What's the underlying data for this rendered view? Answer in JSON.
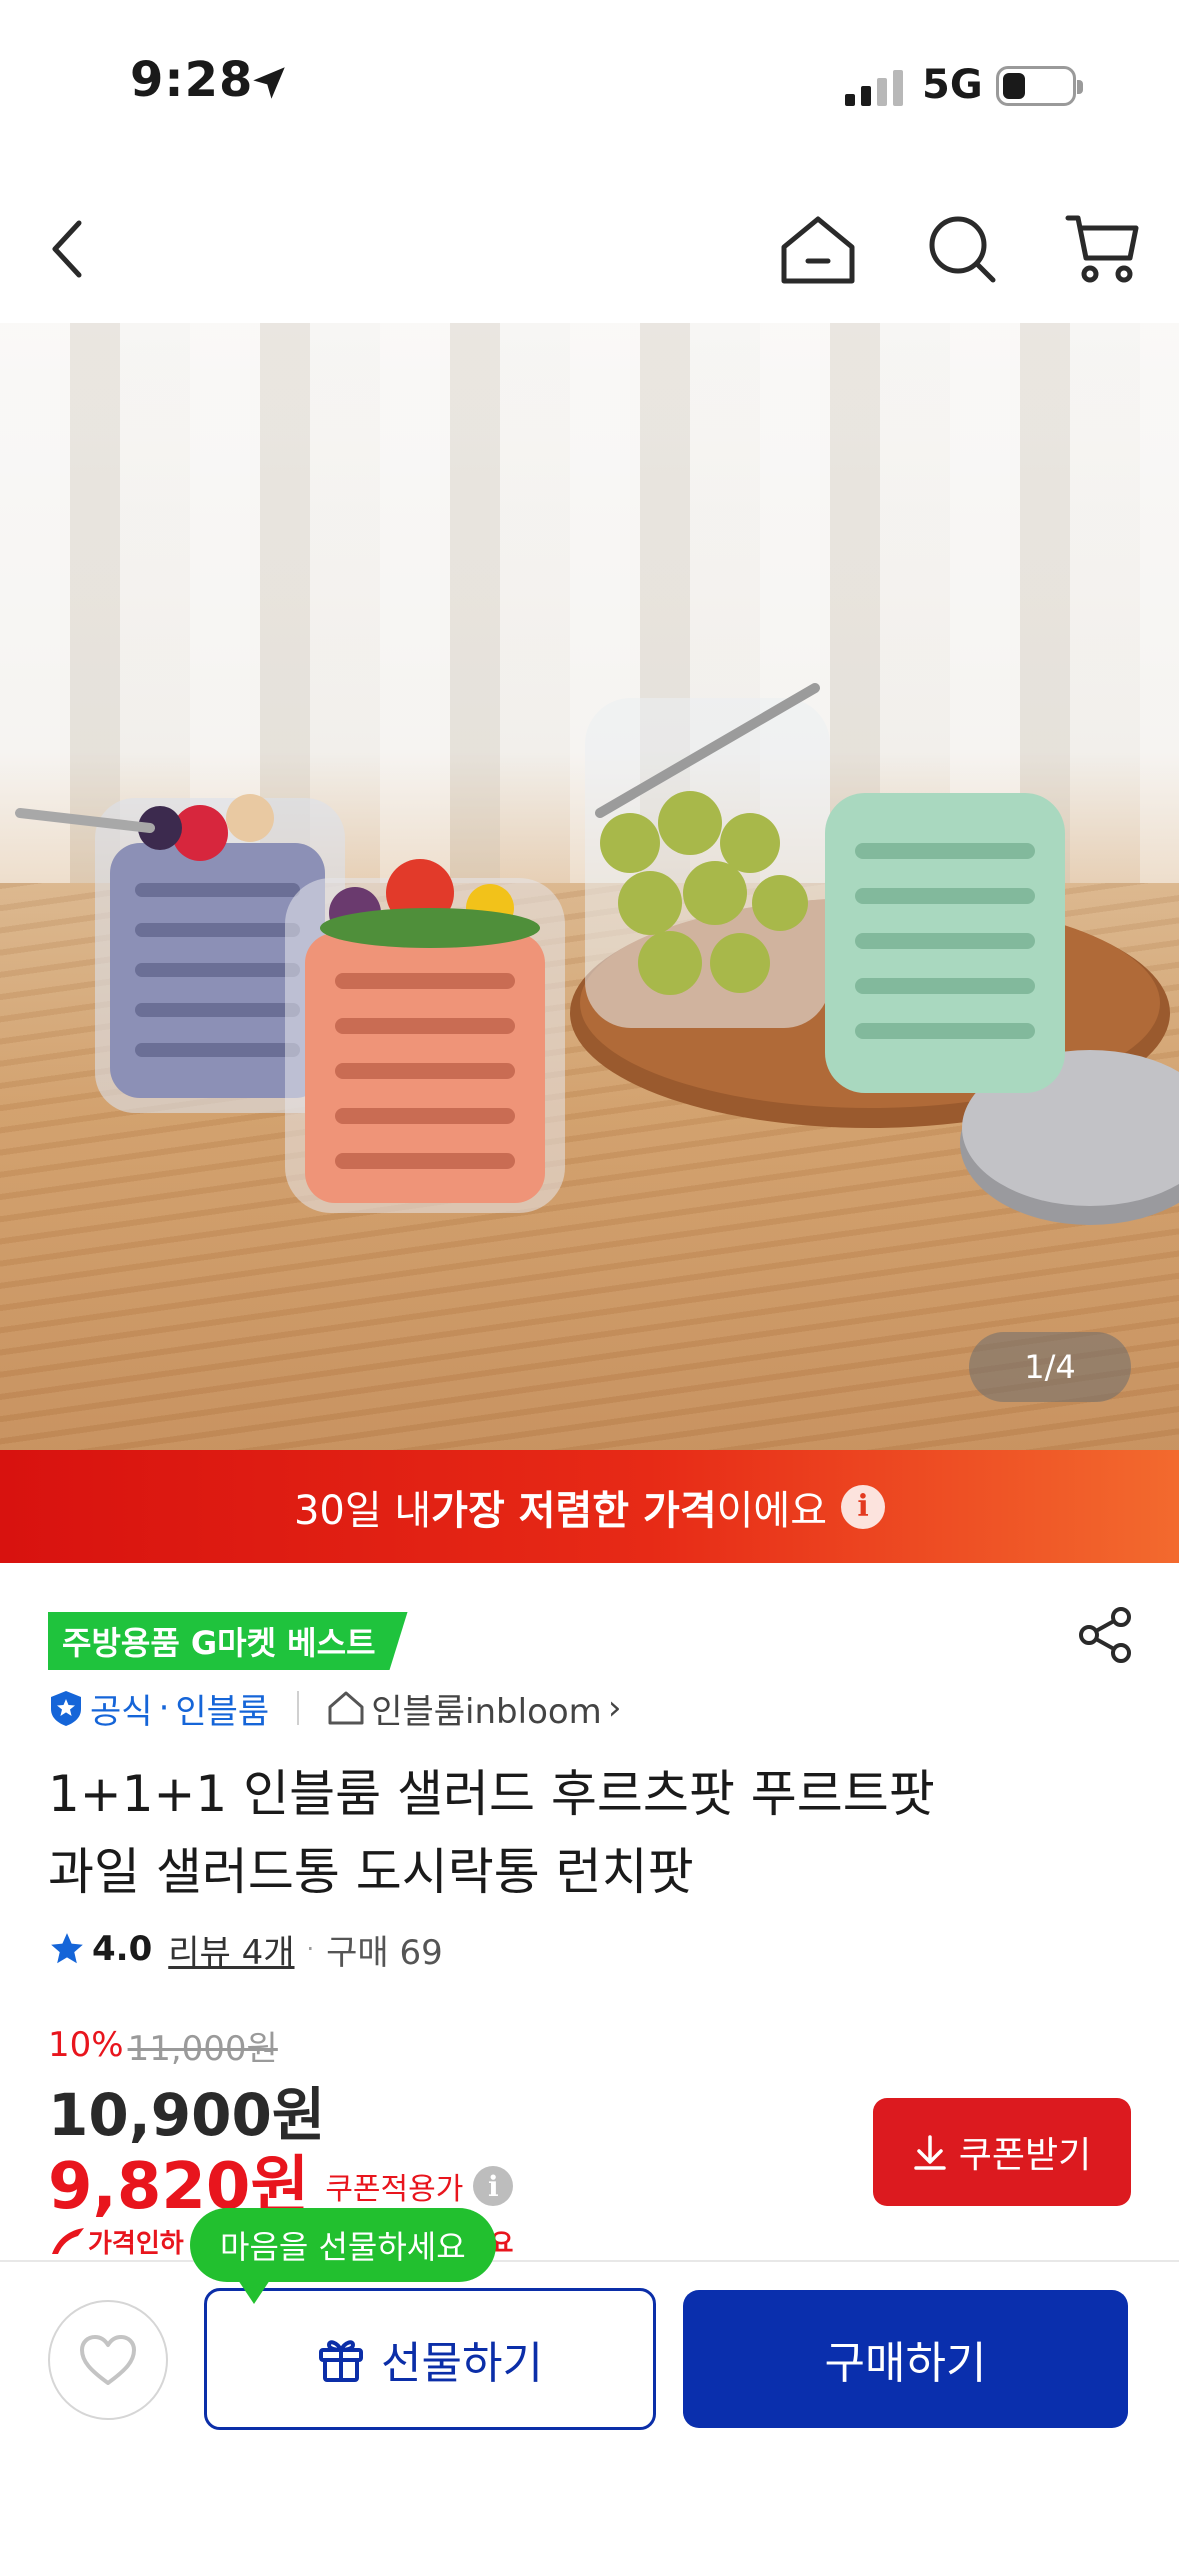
{
  "status_bar": {
    "time": "9:28",
    "network": "5G"
  },
  "nav": {
    "back_icon": "chevron-left-icon",
    "home_icon": "home-icon",
    "search_icon": "search-icon",
    "cart_icon": "cart-icon"
  },
  "product_image": {
    "page_indicator": "1/4"
  },
  "banner": {
    "text_prefix": "30일 내 ",
    "text_bold": "가장 저렴한 가격",
    "text_suffix": "이에요",
    "info_glyph": "i",
    "colors": {
      "start": "#d8120f",
      "end": "#f36a2e"
    }
  },
  "product": {
    "best_badge": "주방용품 G마켓 베스트",
    "official_label": "공식",
    "seller_dot": "·",
    "brand_name": "인블룸",
    "store_name": "인블룸inbloom",
    "store_chevron": "›",
    "title_line1": "1+1+1 인블룸 샐러드 후르츠팟 푸르트팟",
    "title_line2": "과일 샐러드통 도시락통 런치팟",
    "rating": "4.0",
    "review_label": "리뷰 4개",
    "mid_dot": "·",
    "sales_label": "구매 69"
  },
  "price": {
    "discount_rate": "10%",
    "original_price": "11,000원",
    "sale_price": "10,900원",
    "coupon_price": "9,820원",
    "coupon_price_label": "쿠폰적용가",
    "coupon_button_label": "쿠폰받기",
    "drop_notice_left": "가격인하",
    "drop_notice_right": "었어요",
    "accent_color": "#e8151d"
  },
  "bottom_bar": {
    "tooltip": "마음을 선물하세요",
    "gift_button_label": "선물하기",
    "buy_button_label": "구매하기",
    "brand_color": "#0a2fad"
  }
}
